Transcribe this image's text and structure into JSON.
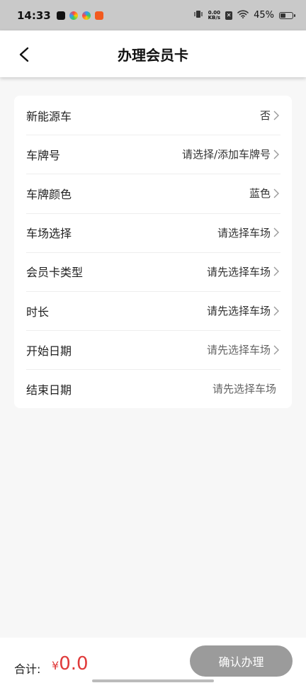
{
  "status": {
    "time": "14:33",
    "net_speed_top": "0.00",
    "net_speed_bottom": "KB/s",
    "battery": "45%"
  },
  "header": {
    "title": "办理会员卡"
  },
  "form": {
    "rows": [
      {
        "label": "新能源车",
        "value": "否"
      },
      {
        "label": "车牌号",
        "value": "请选择/添加车牌号"
      },
      {
        "label": "车牌颜色",
        "value": "蓝色"
      },
      {
        "label": "车场选择",
        "value": "请选择车场"
      },
      {
        "label": "会员卡类型",
        "value": "请先选择车场"
      },
      {
        "label": "时长",
        "value": "请先选择车场"
      },
      {
        "label": "开始日期",
        "value": "请先选择车场"
      },
      {
        "label": "结束日期",
        "value": "请先选择车场"
      }
    ]
  },
  "footer": {
    "total_label": "合计:",
    "currency": "¥",
    "total": "0.0",
    "confirm_label": "确认办理"
  },
  "colors": {
    "accent_price": "#e03a3a",
    "button_disabled": "#9b9b9b"
  }
}
